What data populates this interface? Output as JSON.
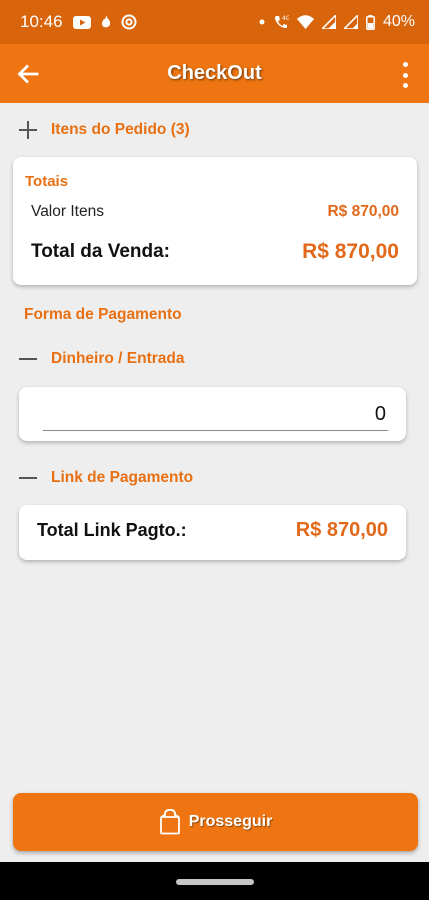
{
  "status_bar": {
    "time": "10:46",
    "battery": "40%",
    "left_icons": [
      "youtube-icon",
      "flame-icon",
      "at-sign-icon"
    ],
    "right_icons": [
      "dot-icon",
      "wifi-call-icon",
      "wifi-icon",
      "signal-icon",
      "signal-icon-2",
      "battery-icon"
    ]
  },
  "app_bar": {
    "title": "CheckOut",
    "back_icon": "arrow-left-icon",
    "menu_icon": "more-vert-icon"
  },
  "items_section": {
    "label": "Itens do Pedido (3)",
    "expanded": false
  },
  "totais": {
    "title": "Totais",
    "valor_itens_label": "Valor Itens",
    "valor_itens_value": "R$ 870,00",
    "total_venda_label": "Total da Venda:",
    "total_venda_value": "R$ 870,00"
  },
  "forma_pagamento": {
    "title": "Forma de Pagamento"
  },
  "dinheiro": {
    "label": "Dinheiro / Entrada",
    "value": "0"
  },
  "link_pagamento": {
    "label": "Link de Pagamento",
    "total_label": "Total Link Pagto.:",
    "total_value": "R$ 870,00"
  },
  "proceed_button": {
    "label": "Prosseguir",
    "icon": "shopping-bag-icon"
  },
  "colors": {
    "primary": "#ee7511",
    "status_bar": "#d8650b",
    "accent_text": "#e2691a",
    "background": "#eeeeee"
  }
}
